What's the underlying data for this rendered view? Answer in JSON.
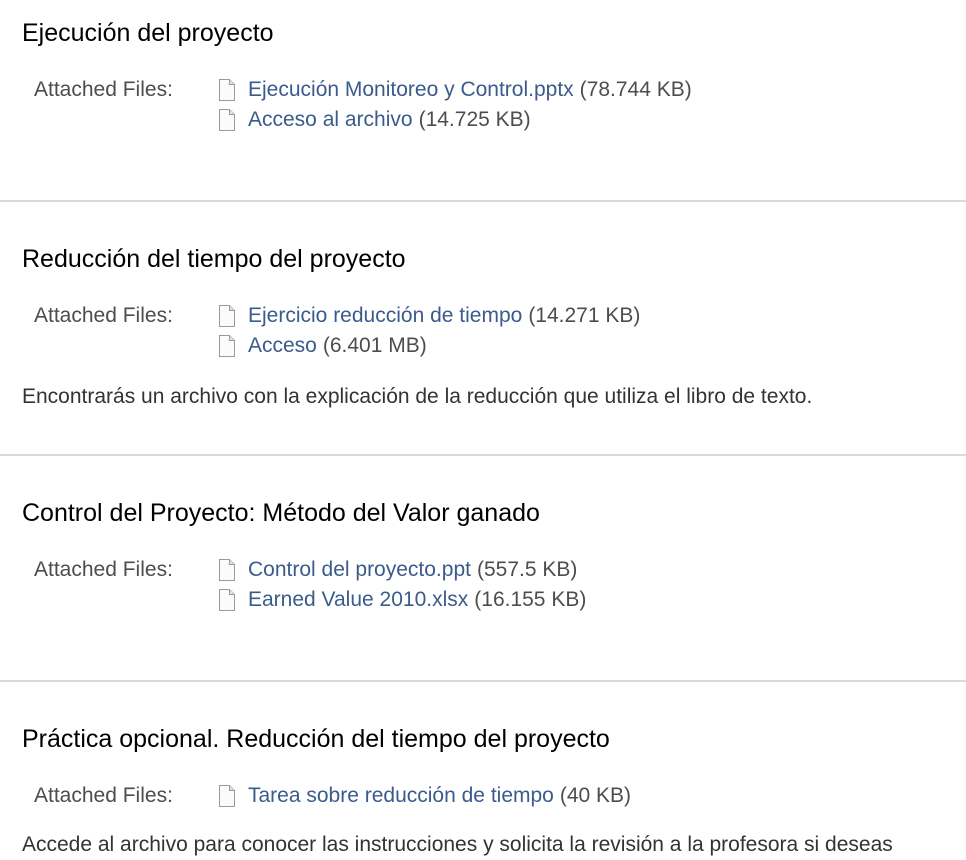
{
  "items": [
    {
      "title": "Ejecución del proyecto",
      "files_label": "Attached Files:",
      "files": [
        {
          "name": "Ejecución Monitoreo y Control.pptx",
          "size": "(78.744 KB)"
        },
        {
          "name": "Acceso al archivo",
          "size": "(14.725 KB)"
        }
      ]
    },
    {
      "title": "Reducción del tiempo del proyecto",
      "files_label": "Attached Files:",
      "files": [
        {
          "name": "Ejercicio reducción de tiempo",
          "size": "(14.271 KB)"
        },
        {
          "name": "Acceso",
          "size": "(6.401 MB)"
        }
      ],
      "description": "Encontrarás un archivo con la explicación de la reducción que utiliza el libro de texto."
    },
    {
      "title": "Control del Proyecto: Método del Valor ganado",
      "files_label": "Attached Files:",
      "files": [
        {
          "name": "Control del proyecto.ppt",
          "size": "(557.5 KB)"
        },
        {
          "name": "Earned Value 2010.xlsx",
          "size": "(16.155 KB)"
        }
      ]
    },
    {
      "title": "Práctica opcional. Reducción del tiempo del proyecto",
      "files_label": "Attached Files:",
      "files": [
        {
          "name": "Tarea sobre reducción de tiempo",
          "size": "(40 KB)"
        }
      ],
      "description": "Accede al archivo para conocer las instrucciones y solicita la revisión a la profesora si deseas"
    }
  ],
  "icons": {
    "file": "document-icon"
  },
  "colors": {
    "link": "#3b5b8c",
    "label": "#4d4d4d",
    "divider": "#d9d9d9"
  }
}
